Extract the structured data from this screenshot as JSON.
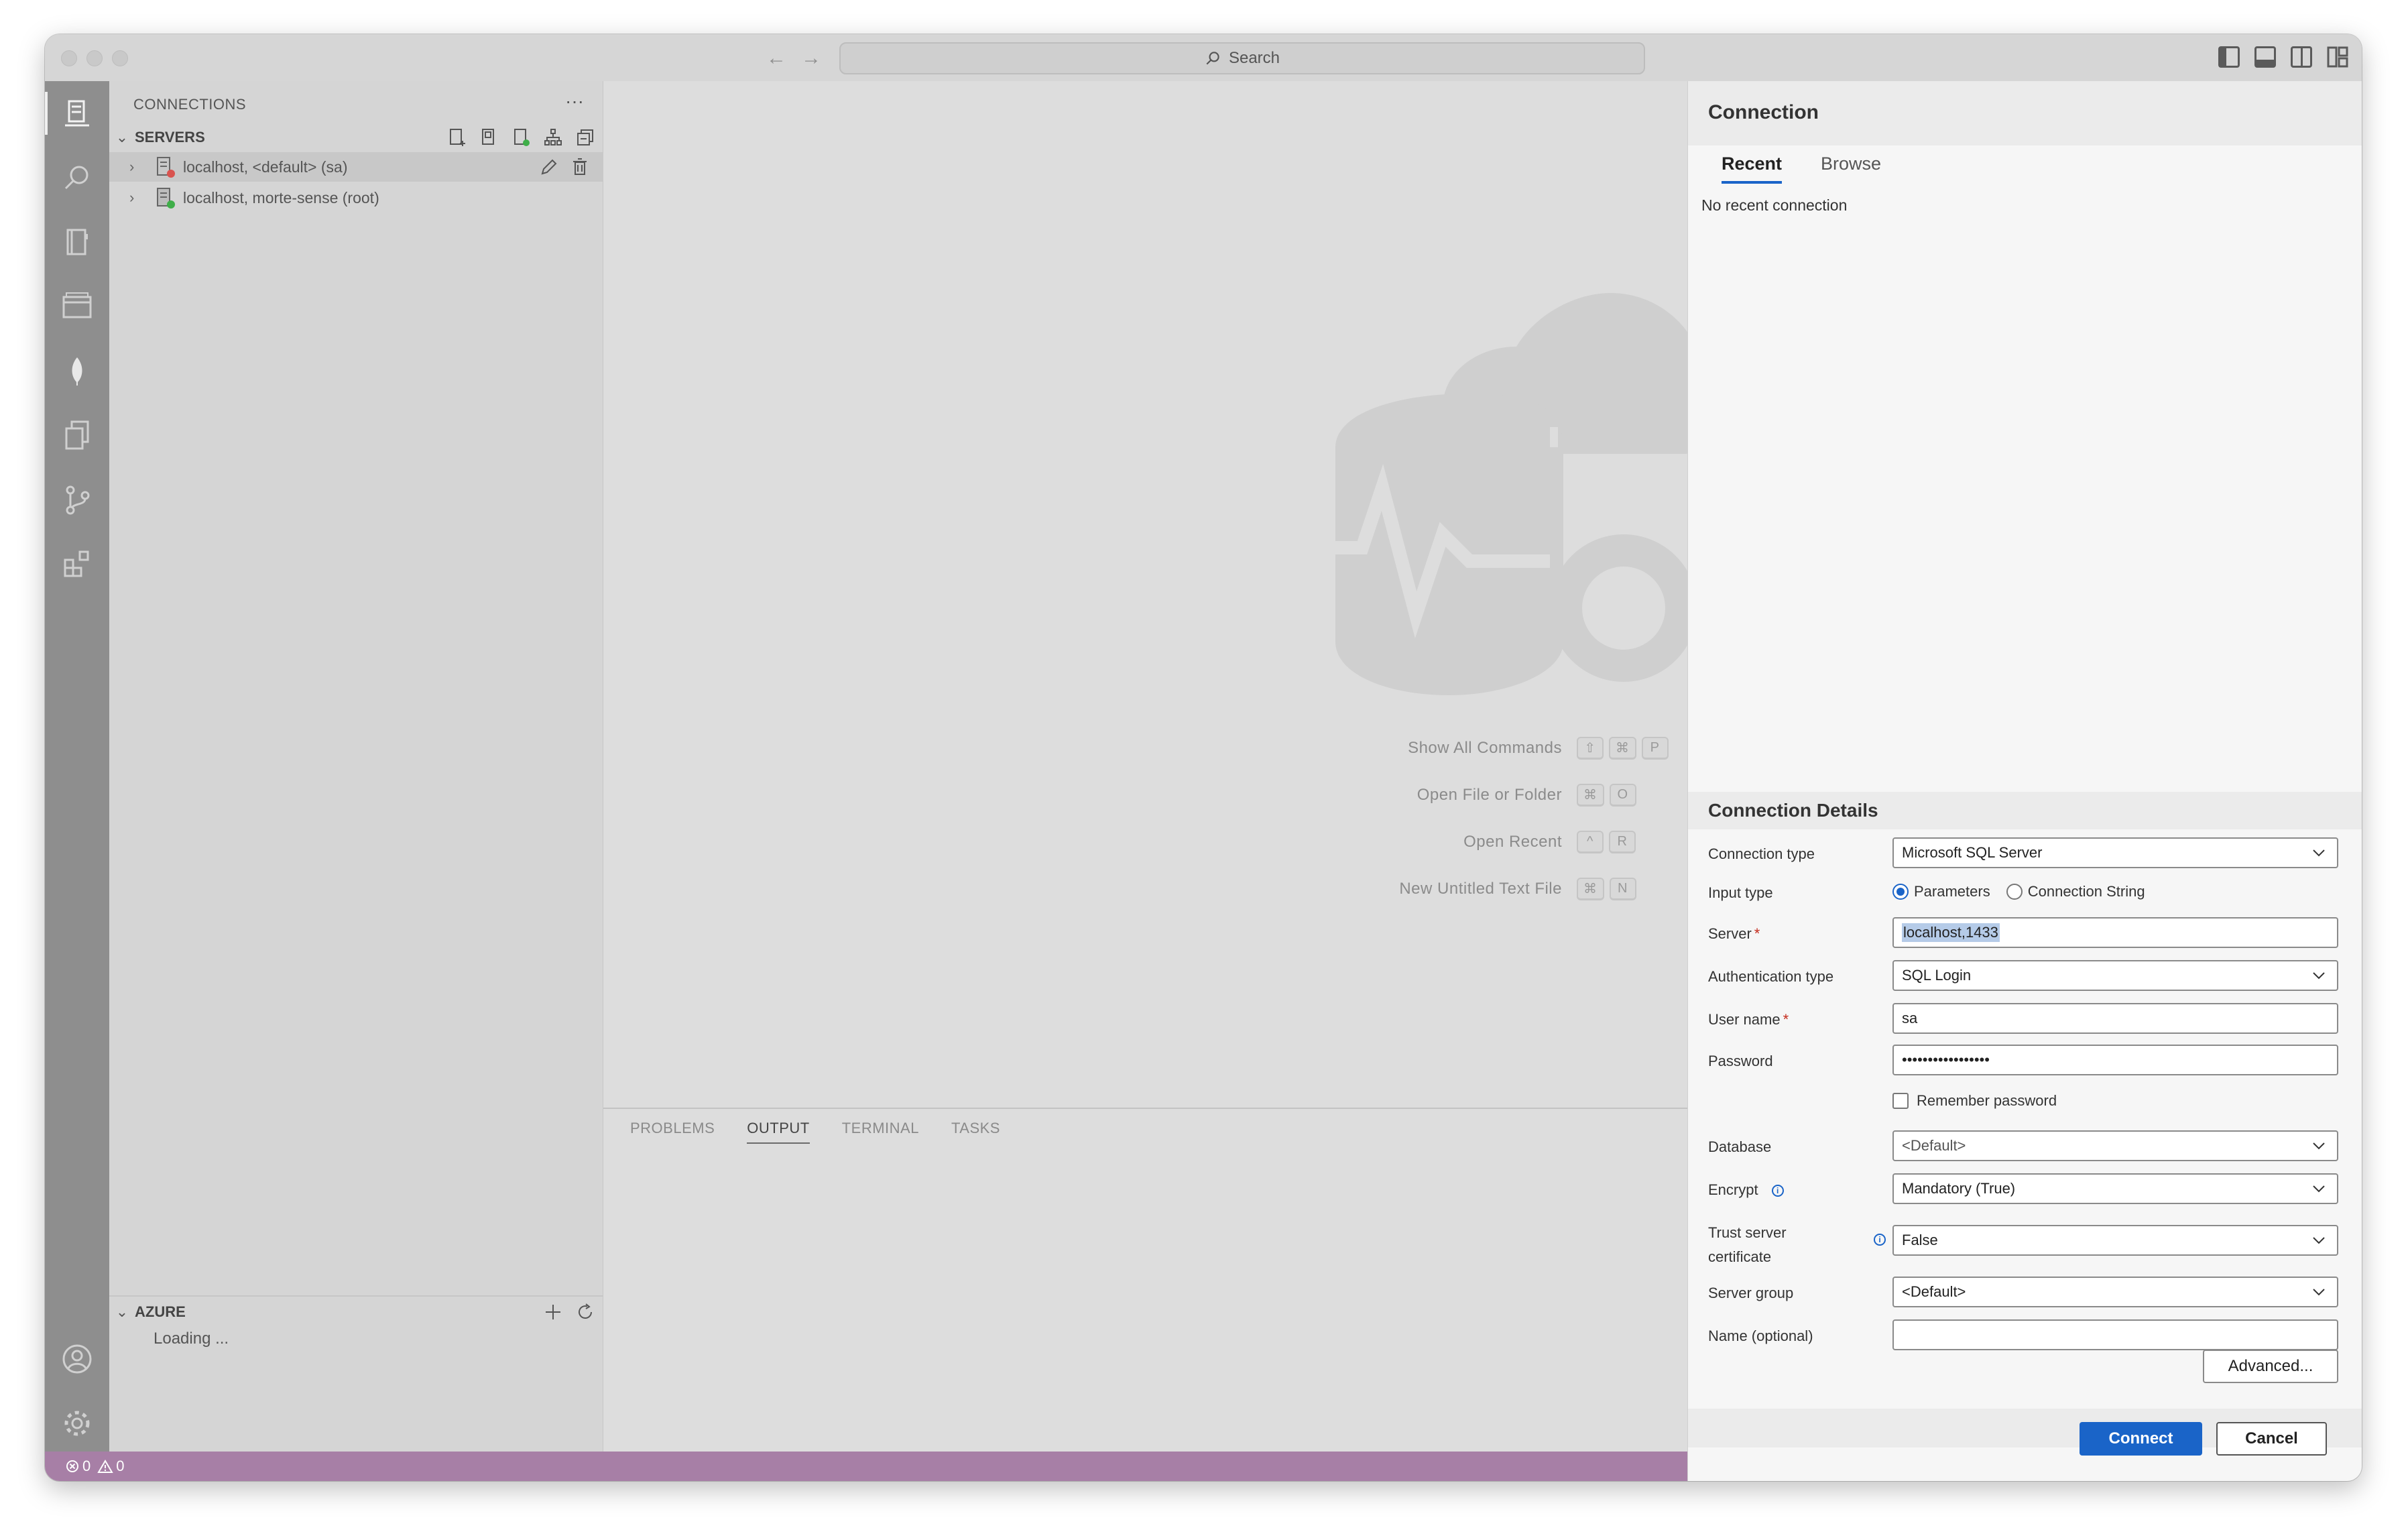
{
  "titlebar": {
    "search_placeholder": "Search"
  },
  "sidebar": {
    "title": "CONNECTIONS",
    "more": "···",
    "servers_section": "SERVERS",
    "servers": [
      {
        "label": "localhost, <default> (sa)",
        "status_color": "#d9534f"
      },
      {
        "label": "localhost, morte-sense (root)",
        "status_color": "#3fae49"
      }
    ],
    "azure_section": "AZURE",
    "azure_loading": "Loading ..."
  },
  "editor": {
    "shortcuts": [
      {
        "label": "Show All Commands",
        "keys": [
          "⇧",
          "⌘",
          "P"
        ]
      },
      {
        "label": "Open File or Folder",
        "keys": [
          "⌘",
          "O"
        ]
      },
      {
        "label": "Open Recent",
        "keys": [
          "^",
          "R"
        ]
      },
      {
        "label": "New Untitled Text File",
        "keys": [
          "⌘",
          "N"
        ]
      }
    ]
  },
  "panel": {
    "tabs": [
      "PROBLEMS",
      "OUTPUT",
      "TERMINAL",
      "TASKS"
    ],
    "active_tab": "OUTPUT"
  },
  "statusbar": {
    "errors": "0",
    "warnings": "0",
    "color": "#a77fa6"
  },
  "connection": {
    "title": "Connection",
    "tabs": [
      "Recent",
      "Browse"
    ],
    "active_tab": "Recent",
    "no_recent": "No recent connection",
    "details_title": "Connection Details",
    "fields": {
      "connection_type_label": "Connection type",
      "connection_type_value": "Microsoft SQL Server",
      "input_type_label": "Input type",
      "input_type_options": [
        "Parameters",
        "Connection String"
      ],
      "input_type_selected": "Parameters",
      "server_label": "Server",
      "server_value": "localhost,1433",
      "auth_type_label": "Authentication type",
      "auth_type_value": "SQL Login",
      "username_label": "User name",
      "username_value": "sa",
      "password_label": "Password",
      "password_value": "•••••••••••••••••",
      "remember_password_label": "Remember password",
      "remember_password_checked": false,
      "database_label": "Database",
      "database_value": "<Default>",
      "encrypt_label": "Encrypt",
      "encrypt_value": "Mandatory (True)",
      "trust_cert_label_1": "Trust server",
      "trust_cert_label_2": "certificate",
      "trust_cert_value": "False",
      "server_group_label": "Server group",
      "server_group_value": "<Default>",
      "name_label": "Name (optional)",
      "name_value": ""
    },
    "advanced_button": "Advanced...",
    "connect_button": "Connect",
    "cancel_button": "Cancel",
    "accent_color": "#1a64c8"
  }
}
